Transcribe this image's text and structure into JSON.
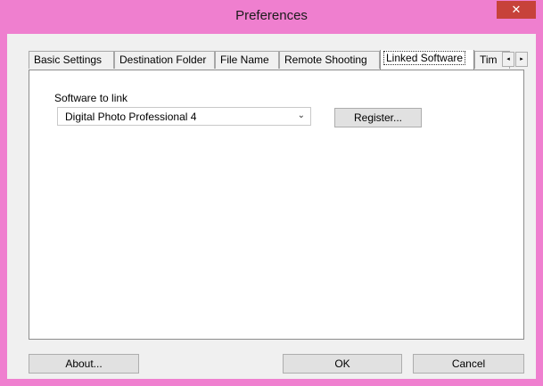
{
  "window": {
    "title": "Preferences",
    "close_glyph": "✕",
    "accent_color": "#ef7fcf",
    "close_color": "#c7423a"
  },
  "tabs": [
    {
      "label": "Basic Settings",
      "active": false
    },
    {
      "label": "Destination Folder",
      "active": false
    },
    {
      "label": "File Name",
      "active": false
    },
    {
      "label": "Remote Shooting",
      "active": false
    },
    {
      "label": "Linked Software",
      "active": true
    },
    {
      "label": "Tim",
      "active": false
    }
  ],
  "tab_scroll": {
    "left_icon": "◂",
    "right_icon": "▸"
  },
  "linked_software": {
    "label": "Software to link",
    "selected": "Digital Photo Professional 4",
    "dropdown_icon": "⌄",
    "register_label": "Register..."
  },
  "footer": {
    "about_label": "About...",
    "ok_label": "OK",
    "cancel_label": "Cancel"
  }
}
